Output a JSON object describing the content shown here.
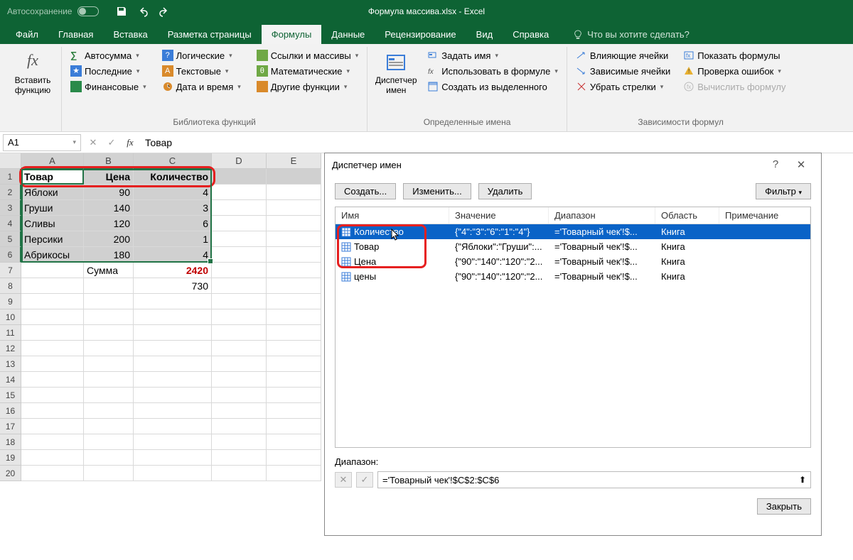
{
  "titlebar": {
    "autosave_label": "Автосохранение",
    "doc_title": "Формула массива.xlsx - Excel"
  },
  "tabs": {
    "file": "Файл",
    "home": "Главная",
    "insert": "Вставка",
    "pagelayout": "Разметка страницы",
    "formulas": "Формулы",
    "data": "Данные",
    "review": "Рецензирование",
    "view": "Вид",
    "help": "Справка",
    "tellme": "Что вы хотите сделать?"
  },
  "ribbon": {
    "insert_function": "Вставить функцию",
    "autosum": "Автосумма",
    "recent": "Последние",
    "financial": "Финансовые",
    "logical": "Логические",
    "text": "Текстовые",
    "datetime": "Дата и время",
    "lookup": "Ссылки и массивы",
    "math": "Математические",
    "more": "Другие функции",
    "lib_label": "Библиотека функций",
    "name_manager": "Диспетчер имен",
    "define_name": "Задать имя",
    "use_in_formula": "Использовать в формуле",
    "create_from_sel": "Создать из выделенного",
    "defined_label": "Определенные имена",
    "trace_precedents": "Влияющие ячейки",
    "trace_dependents": "Зависимые ячейки",
    "remove_arrows": "Убрать стрелки",
    "show_formulas": "Показать формулы",
    "error_check": "Проверка ошибок",
    "evaluate": "Вычислить формулу",
    "audit_label": "Зависимости формул"
  },
  "formula_bar": {
    "name_box": "A1",
    "formula": "Товар"
  },
  "grid": {
    "columns": [
      "A",
      "B",
      "C",
      "D",
      "E"
    ],
    "rows": [
      {
        "n": 1,
        "a": "Товар",
        "b": "Цена",
        "c": "Количество",
        "bold": true
      },
      {
        "n": 2,
        "a": "Яблоки",
        "b": "90",
        "c": "4"
      },
      {
        "n": 3,
        "a": "Груши",
        "b": "140",
        "c": "3"
      },
      {
        "n": 4,
        "a": "Сливы",
        "b": "120",
        "c": "6"
      },
      {
        "n": 5,
        "a": "Персики",
        "b": "200",
        "c": "1"
      },
      {
        "n": 6,
        "a": "Абрикосы",
        "b": "180",
        "c": "4"
      },
      {
        "n": 7,
        "a": "",
        "b": "Сумма",
        "c": "2420",
        "cred": true
      },
      {
        "n": 8,
        "a": "",
        "b": "",
        "c": "730"
      },
      {
        "n": 9
      },
      {
        "n": 10
      },
      {
        "n": 11
      },
      {
        "n": 12
      },
      {
        "n": 13
      },
      {
        "n": 14
      },
      {
        "n": 15
      },
      {
        "n": 16
      },
      {
        "n": 17
      },
      {
        "n": 18
      },
      {
        "n": 19
      },
      {
        "n": 20
      }
    ]
  },
  "dialog": {
    "title": "Диспетчер имен",
    "btn_new": "Создать...",
    "btn_edit": "Изменить...",
    "btn_delete": "Удалить",
    "btn_filter": "Фильтр",
    "cols": {
      "name": "Имя",
      "value": "Значение",
      "range": "Диапазон",
      "scope": "Область",
      "comment": "Примечание"
    },
    "rows": [
      {
        "name": "Количество",
        "value": "{\"4\":\"3\":\"6\":\"1\":\"4\"}",
        "range": "='Товарный чек'!$...",
        "scope": "Книга",
        "selected": true
      },
      {
        "name": "Товар",
        "value": "{\"Яблоки\":\"Груши\":...",
        "range": "='Товарный чек'!$...",
        "scope": "Книга"
      },
      {
        "name": "Цена",
        "value": "{\"90\":\"140\":\"120\":\"2...",
        "range": "='Товарный чек'!$...",
        "scope": "Книга"
      },
      {
        "name": "цены",
        "value": "{\"90\":\"140\":\"120\":\"2...",
        "range": "='Товарный чек'!$...",
        "scope": "Книга"
      }
    ],
    "range_label": "Диапазон:",
    "range_value": "='Товарный чек'!$C$2:$C$6",
    "btn_close": "Закрыть"
  }
}
